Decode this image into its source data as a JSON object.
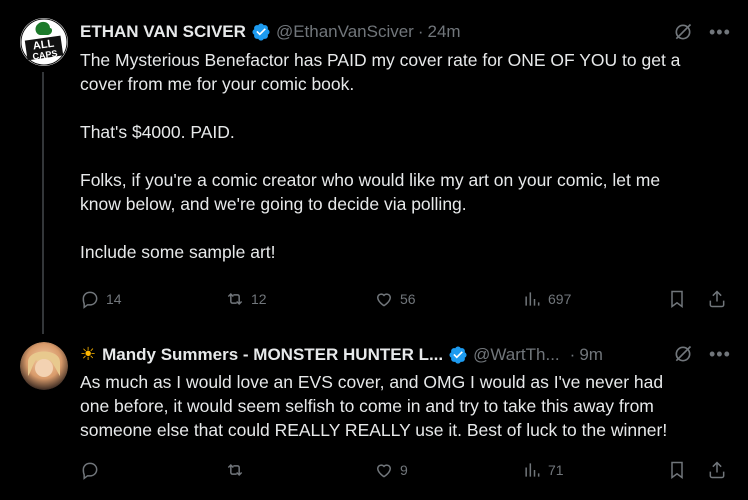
{
  "tweets": [
    {
      "author_name": "ETHAN VAN SCIVER",
      "handle": "@EthanVanSciver",
      "dot": "·",
      "time": "24m",
      "text": "The Mysterious Benefactor has PAID my cover rate for ONE OF YOU to get a\ncover from me for your comic book.\n\nThat's $4000.  PAID.\n\nFolks, if you're a comic creator who would like my art on your comic, let me\nknow below, and we're going to decide via polling.\n\nInclude some sample art!",
      "replies": "14",
      "reposts": "12",
      "likes": "56",
      "views": "697",
      "avatar_text": "ALL CAPS COMICS"
    },
    {
      "author_emoji": "☀",
      "author_name": "Mandy Summers - MONSTER HUNTER L...",
      "handle": "@WartTh...",
      "dot": "·",
      "time": "9m",
      "text": "As much as I would love an EVS cover, and OMG I would as I've never had\none before, it would seem selfish to come in and try to take this away from\nsomeone else that could REALLY REALLY use it. Best of luck to the winner!",
      "replies": "",
      "reposts": "",
      "likes": "9",
      "views": "71"
    }
  ],
  "colors": {
    "background": "#000000",
    "text": "#e7e9ea",
    "muted": "#71767b",
    "verified": "#1d9bf0"
  },
  "icons": [
    "reply-icon",
    "repost-icon",
    "like-icon",
    "views-icon",
    "bookmark-icon",
    "share-icon",
    "grok-icon",
    "more-icon",
    "verified-badge-icon"
  ]
}
